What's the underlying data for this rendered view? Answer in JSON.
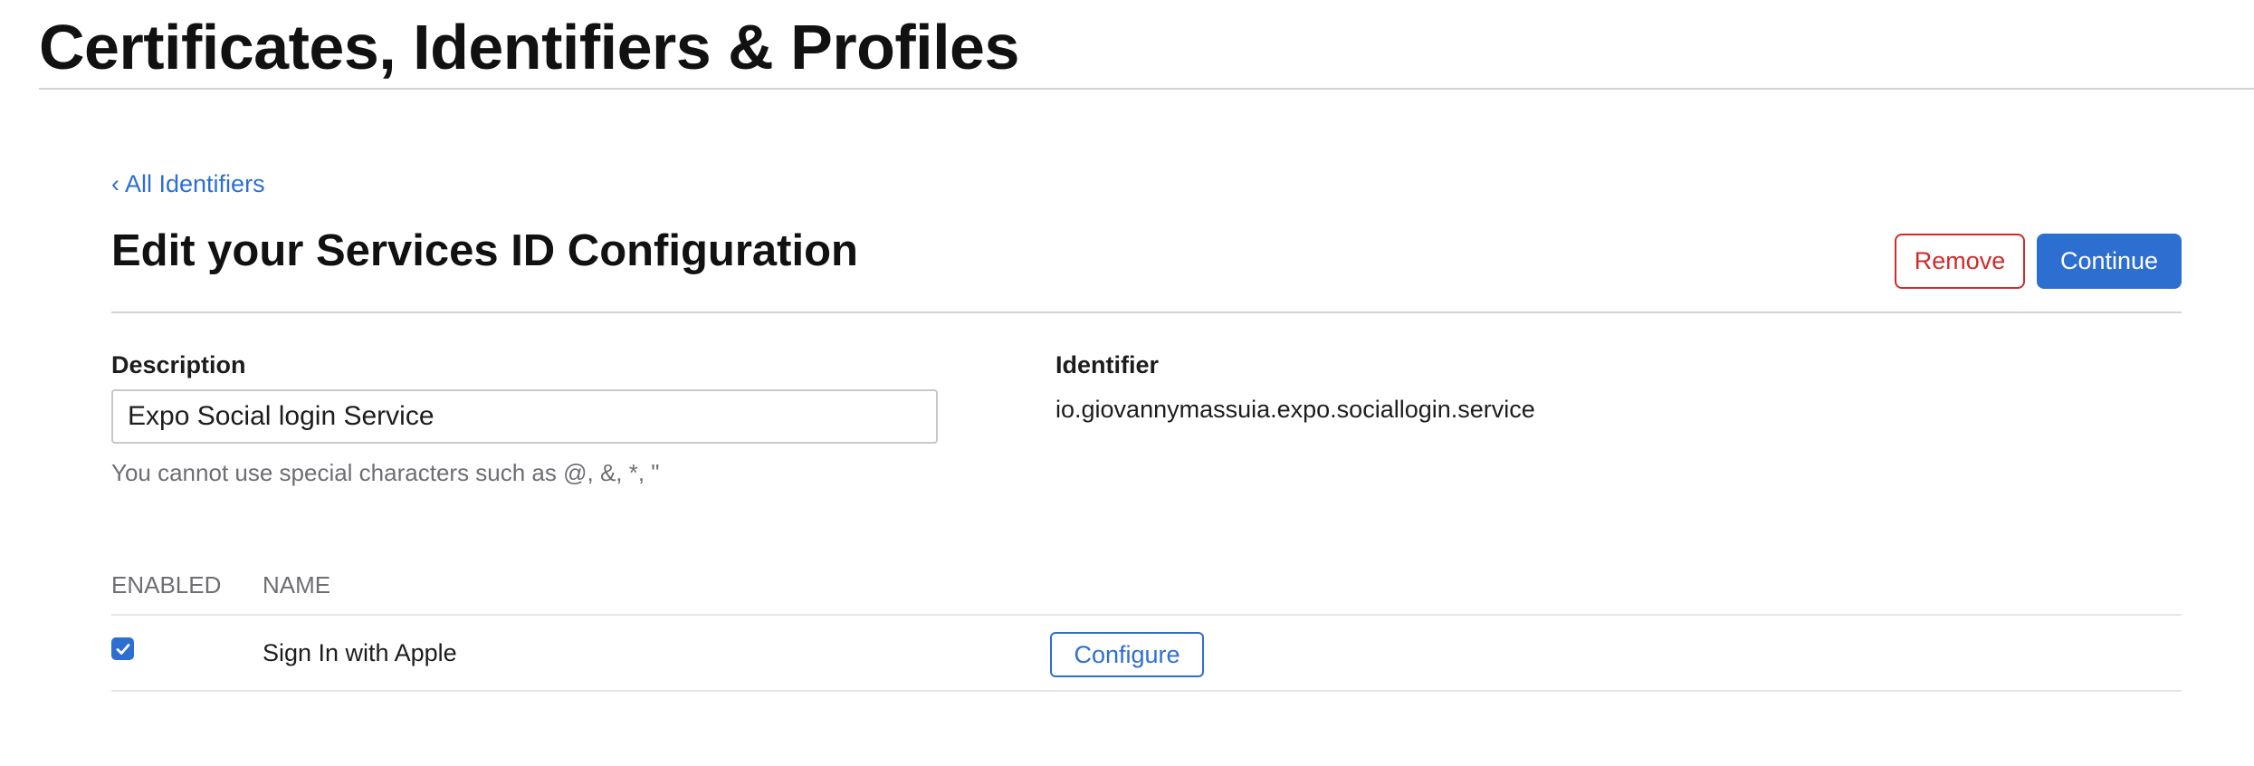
{
  "header": {
    "title": "Certificates, Identifiers & Profiles"
  },
  "nav": {
    "back_chevron": "‹",
    "back_label": "All Identifiers"
  },
  "form": {
    "title": "Edit your Services ID Configuration",
    "remove_label": "Remove",
    "continue_label": "Continue",
    "description_label": "Description",
    "description_value": "Expo Social login Service",
    "description_helper": "You cannot use special characters such as @, &, *, \"",
    "identifier_label": "Identifier",
    "identifier_value": "io.giovannymassuia.expo.sociallogin.service"
  },
  "capabilities": {
    "headers": [
      "ENABLED",
      "NAME"
    ],
    "rows": [
      {
        "enabled": true,
        "name": "Sign In with Apple",
        "action_label": "Configure"
      }
    ]
  },
  "colors": {
    "accent": "#2d6fd1",
    "danger": "#d12b2b"
  }
}
